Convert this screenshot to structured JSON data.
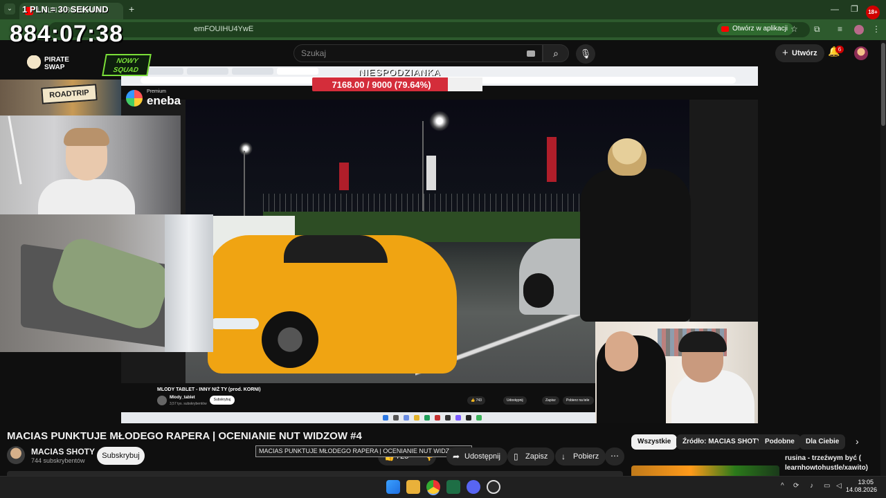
{
  "browser": {
    "tab_title": "1 PLN = 30 SEKUND",
    "url_fragment": "emFOUIHU4YwE",
    "open_in_app": "Otwórz w aplikacji",
    "new_tab": "+",
    "badge": "18+"
  },
  "overlay": {
    "tab_overlay_text": "1 PLN = 30 SEKUND",
    "timer": "884:07:38",
    "pirate_swap": "PIRATE SWAP",
    "nowy_squad": "NOWY SQUAD",
    "roadtrip": "ROADTRIP",
    "eneba_premium": "Premium",
    "eneba_name": "eneba",
    "goal_title": "NIESPODZIANKA",
    "goal_progress": "7168.00 / 9000 (79.64%)",
    "goal_fraction": 0.7964
  },
  "youtube": {
    "search_placeholder": "Szukaj",
    "create_label": "Utwórz",
    "notif_count": "6"
  },
  "inner_video": {
    "title": "MLODY TABLET - INNY NIŻ TY (prod. KORNI)",
    "channel": "Mlody_tablet",
    "subs": "3,57 tys. subskrybentów",
    "subscribe": "Subskrybuj",
    "likes": "743",
    "share": "Udostępnij",
    "save": "Zapisz",
    "download": "Pobierz na tele"
  },
  "video": {
    "title": "MACIAS PUNKTUJE MŁODEGO RAPERA | OCENIANIE NUT WIDZOW #4",
    "channel": "MACIAS SHOTY",
    "subs": "744 subskrybentów",
    "subscribe": "Subskrybuj",
    "tooltip": "MACIAS PUNKTUJE MŁODEGO RAPERA | OCENIANIE NUT WIDZOW #4",
    "likes": "725",
    "share": "Udostępnij",
    "save": "Zapisz",
    "download": "Pobierz",
    "more": "⋯"
  },
  "chips": [
    "Wszystkie",
    "Źródło: MACIAS SHOTY",
    "Podobne",
    "Dla Ciebie"
  ],
  "recommendation": {
    "title": "rusina - trzeźwym być (",
    "subtitle": "learnhowtohustle/xawito)"
  },
  "taskbar": {
    "time": "13:05",
    "date": "14.08.2026"
  }
}
